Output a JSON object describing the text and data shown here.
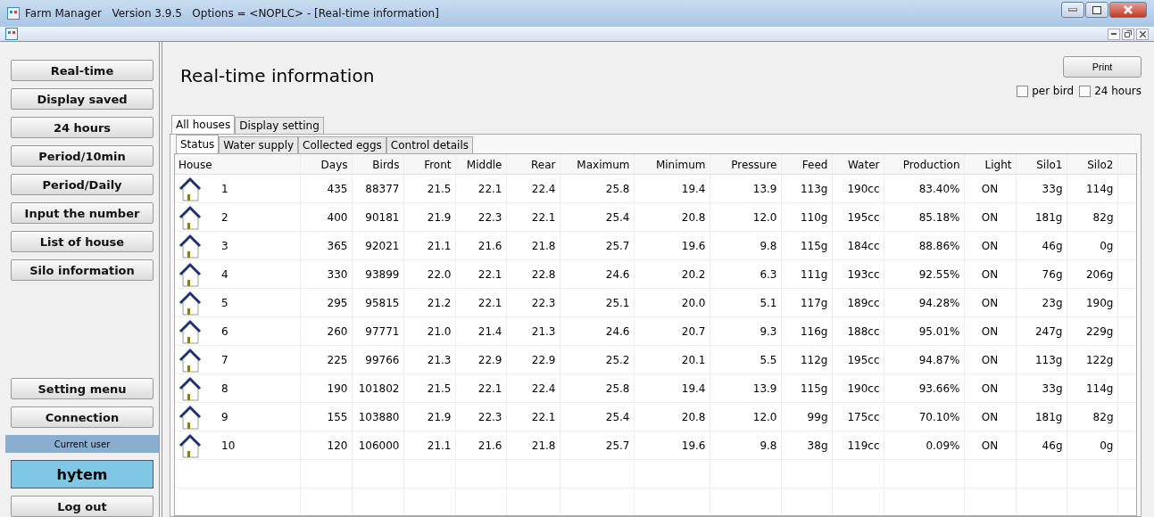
{
  "window": {
    "title": "Farm Manager   Version 3.9.5   Options = <NOPLC> - [Real-time information]"
  },
  "sidebar": {
    "buttons": [
      "Real-time",
      "Display saved",
      "24 hours",
      "Period/10min",
      "Period/Daily",
      "Input the number",
      "List of house",
      "Silo information"
    ],
    "lower_buttons": [
      "Setting menu",
      "Connection"
    ],
    "user_label": "Current user",
    "user": "hytem",
    "logout": "Log out"
  },
  "page": {
    "title": "Real-time information",
    "print": "Print",
    "options": [
      {
        "label": "per bird",
        "checked": false
      },
      {
        "label": "24 hours",
        "checked": false
      }
    ]
  },
  "tabs": [
    {
      "label": "All houses",
      "selected": true
    },
    {
      "label": "Display setting",
      "selected": false
    }
  ],
  "subtabs": [
    {
      "label": "Status",
      "selected": true
    },
    {
      "label": "Water supply",
      "selected": false
    },
    {
      "label": "Collected eggs",
      "selected": false
    },
    {
      "label": "Control details",
      "selected": false
    }
  ],
  "table": {
    "columns": [
      "House",
      "Days",
      "Birds",
      "Front",
      "Middle",
      "Rear",
      "Maximum",
      "Minimum",
      "Pressure",
      "Feed",
      "Water",
      "Production",
      "Light",
      "Silo1",
      "Silo2"
    ],
    "rows": [
      [
        "1",
        "435",
        "88377",
        "21.5",
        "22.1",
        "22.4",
        "25.8",
        "19.4",
        "13.9",
        "113g",
        "190cc",
        "83.40%",
        "ON",
        "33g",
        "114g"
      ],
      [
        "2",
        "400",
        "90181",
        "21.9",
        "22.3",
        "22.1",
        "25.4",
        "20.8",
        "12.0",
        "110g",
        "195cc",
        "85.18%",
        "ON",
        "181g",
        "82g"
      ],
      [
        "3",
        "365",
        "92021",
        "21.1",
        "21.6",
        "21.8",
        "25.7",
        "19.6",
        "9.8",
        "115g",
        "184cc",
        "88.86%",
        "ON",
        "46g",
        "0g"
      ],
      [
        "4",
        "330",
        "93899",
        "22.0",
        "22.1",
        "22.8",
        "24.6",
        "20.2",
        "6.3",
        "111g",
        "193cc",
        "92.55%",
        "ON",
        "76g",
        "206g"
      ],
      [
        "5",
        "295",
        "95815",
        "21.2",
        "22.1",
        "22.3",
        "25.1",
        "20.0",
        "5.1",
        "117g",
        "189cc",
        "94.28%",
        "ON",
        "23g",
        "190g"
      ],
      [
        "6",
        "260",
        "97771",
        "21.0",
        "21.4",
        "21.3",
        "24.6",
        "20.7",
        "9.3",
        "116g",
        "188cc",
        "95.01%",
        "ON",
        "247g",
        "229g"
      ],
      [
        "7",
        "225",
        "99766",
        "21.3",
        "22.9",
        "22.9",
        "25.2",
        "20.1",
        "5.5",
        "112g",
        "195cc",
        "94.87%",
        "ON",
        "113g",
        "122g"
      ],
      [
        "8",
        "190",
        "101802",
        "21.5",
        "22.1",
        "22.4",
        "25.8",
        "19.4",
        "13.9",
        "115g",
        "190cc",
        "93.66%",
        "ON",
        "33g",
        "114g"
      ],
      [
        "9",
        "155",
        "103880",
        "21.9",
        "22.3",
        "22.1",
        "25.4",
        "20.8",
        "12.0",
        "99g",
        "175cc",
        "70.10%",
        "ON",
        "181g",
        "82g"
      ],
      [
        "10",
        "120",
        "106000",
        "21.1",
        "21.6",
        "21.8",
        "25.7",
        "19.6",
        "9.8",
        "38g",
        "119cc",
        "0.09%",
        "ON",
        "46g",
        "0g"
      ]
    ]
  }
}
